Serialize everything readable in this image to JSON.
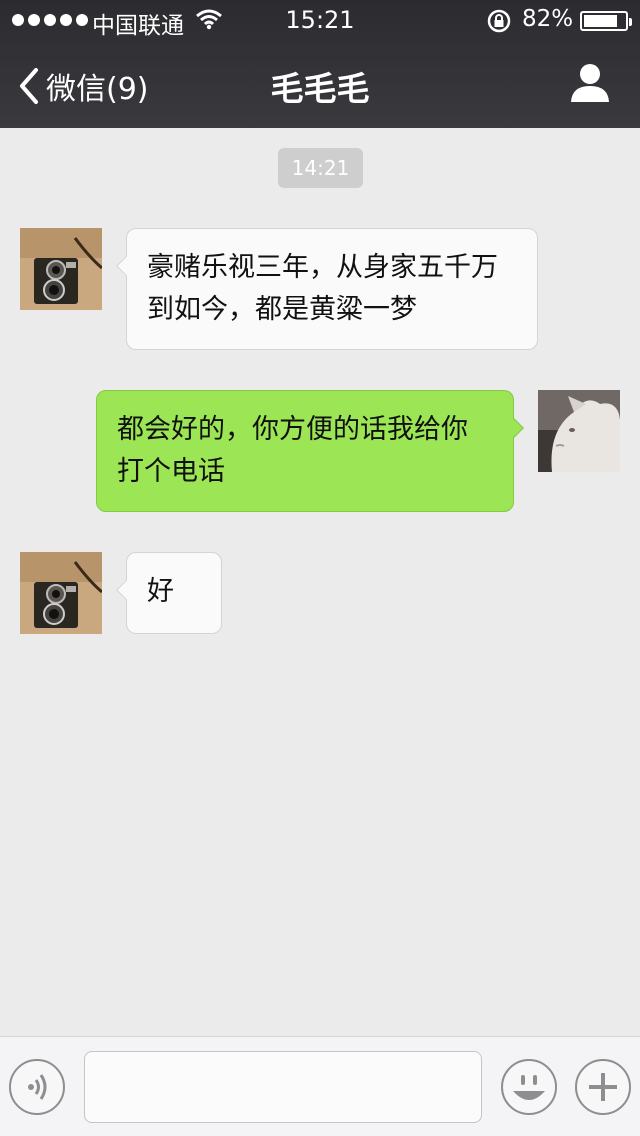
{
  "status_bar": {
    "carrier": "中国联通",
    "time": "15:21",
    "battery_percent": "82%",
    "battery_level": 0.82
  },
  "nav": {
    "back_label": "微信(9)",
    "title": "毛毛毛"
  },
  "chat": {
    "timestamp": "14:21",
    "messages": [
      {
        "direction": "incoming",
        "text": "豪赌乐视三年，从身家五千万到如今，都是黄粱一梦"
      },
      {
        "direction": "outgoing",
        "text": "都会好的，你方便的话我给你打个电话"
      },
      {
        "direction": "incoming",
        "text": "好"
      }
    ]
  },
  "input_bar": {
    "text_value": "",
    "icons": [
      "voice-icon",
      "emoji-icon",
      "plus-icon"
    ]
  },
  "colors": {
    "nav_bg": "#2b2b30",
    "outgoing_bubble": "#9ce554",
    "incoming_bubble": "#fafafa",
    "chat_bg": "#ebebeb"
  }
}
